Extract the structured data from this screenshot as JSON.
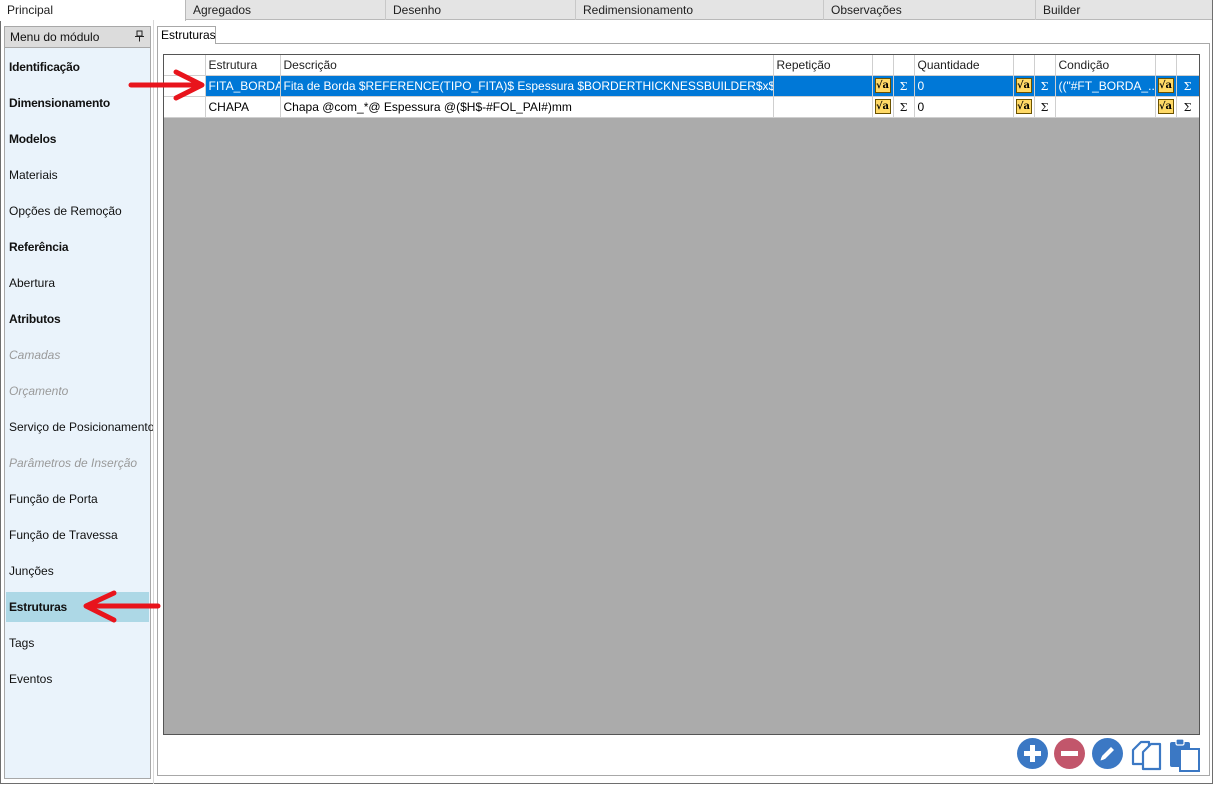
{
  "top_tabs": [
    {
      "label": "Principal"
    },
    {
      "label": "Agregados"
    },
    {
      "label": "Desenho"
    },
    {
      "label": "Redimensionamento"
    },
    {
      "label": "Observações"
    },
    {
      "label": "Builder"
    }
  ],
  "sidebar": {
    "title": "Menu do módulo",
    "pin_icon": "pin-icon",
    "items": [
      {
        "label": "Identificação",
        "style": "bold"
      },
      {
        "label": "Dimensionamento",
        "style": "bold"
      },
      {
        "label": "Modelos",
        "style": "bold"
      },
      {
        "label": "Materiais",
        "style": "normal"
      },
      {
        "label": "Opções de Remoção",
        "style": "normal"
      },
      {
        "label": "Referência",
        "style": "bold"
      },
      {
        "label": "Abertura",
        "style": "normal"
      },
      {
        "label": "Atributos",
        "style": "bold"
      },
      {
        "label": "Camadas",
        "style": "disabled"
      },
      {
        "label": "Orçamento",
        "style": "disabled"
      },
      {
        "label": "Serviço de Posicionamento",
        "style": "normal"
      },
      {
        "label": "Parâmetros de Inserção",
        "style": "disabled"
      },
      {
        "label": "Função de Porta",
        "style": "normal"
      },
      {
        "label": "Função de Travessa",
        "style": "normal"
      },
      {
        "label": "Junções",
        "style": "normal"
      },
      {
        "label": "Estruturas",
        "style": "bold",
        "selected": true
      },
      {
        "label": "Tags",
        "style": "normal"
      },
      {
        "label": "Eventos",
        "style": "normal"
      }
    ]
  },
  "content": {
    "tab_label": "Estruturas",
    "grid": {
      "headers": {
        "estrutura": "Estrutura",
        "descricao": "Descrição",
        "repeticao": "Repetição",
        "quantidade": "Quantidade",
        "condicao": "Condição"
      },
      "rows": [
        {
          "estrutura": "FITA_BORDA",
          "descricao": "Fita de Borda $REFERENCE(TIPO_FITA)$ Espessura $BORDERTHICKNESSBUILDER$x$REFER...",
          "repeticao": "",
          "quantidade": "0",
          "condicao": "((\"#FT_BORDA_...",
          "selected": true
        },
        {
          "estrutura": "CHAPA",
          "descricao": "Chapa @com_*@ Espessura @($H$-#FOL_PAI#)mm",
          "repeticao": "",
          "quantidade": "0",
          "condicao": "",
          "selected": false
        }
      ],
      "formula_icon_glyph": "√a",
      "sigma_icon_glyph": "Σ"
    }
  },
  "colors": {
    "selection": "#0078d7",
    "sidebar_selected": "#add8e6",
    "grid_background": "#ababab",
    "annotation_arrow": "#e8141c"
  },
  "actions": {
    "add_icon": "plus-circle-icon",
    "remove_icon": "minus-circle-icon",
    "edit_icon": "pencil-icon",
    "copy_icon": "copy-icon",
    "paste_icon": "paste-icon"
  }
}
